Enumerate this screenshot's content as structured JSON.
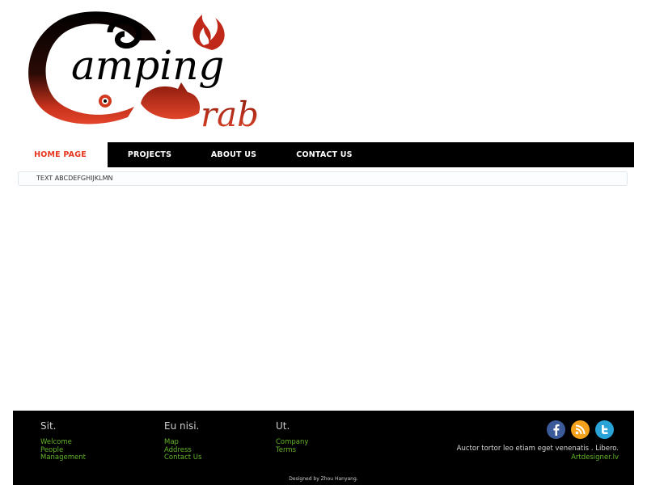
{
  "logo": {
    "line1": "amping",
    "line2": "rab",
    "initial": "C"
  },
  "nav": {
    "items": [
      {
        "label": "HOME PAGE"
      },
      {
        "label": "PROJECTS"
      },
      {
        "label": "ABOUT US"
      },
      {
        "label": "CONTACT US"
      }
    ]
  },
  "content": {
    "text": "TEXT ABCDEFGHIJKLMN"
  },
  "footer": {
    "col1": {
      "title": "Sit.",
      "links": [
        "Welcome",
        "People",
        "Management"
      ]
    },
    "col2": {
      "title": "Eu nisi.",
      "links": [
        "Map",
        "Address",
        "Contact Us"
      ]
    },
    "col3": {
      "title": "Ut.",
      "links": [
        "Company",
        "Terms"
      ]
    },
    "social": [
      "facebook-icon",
      "rss-icon",
      "twitter-icon"
    ],
    "text": "Auctor tortor leo etiam eget venenatis . Libero.",
    "link": "Artdesigner.lv",
    "credit": "Designed by Zhou Hanyang."
  },
  "colors": {
    "accent": "#e8361e",
    "link": "#63b52a",
    "bar": "#000000"
  }
}
